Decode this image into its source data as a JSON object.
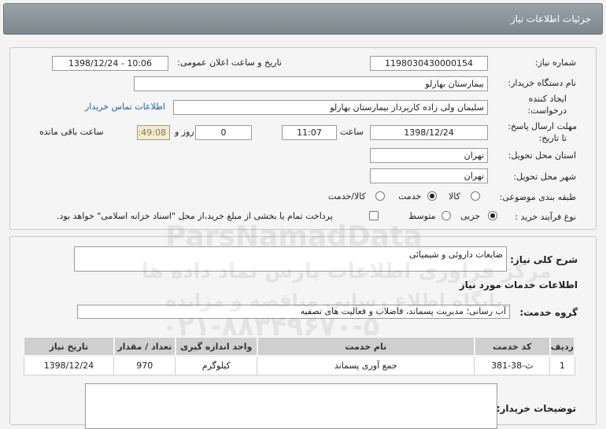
{
  "header": {
    "title": "جزئیات اطلاعات نیاز"
  },
  "details": {
    "need_number_label": "شماره نیاز:",
    "need_number": "1198030430000154",
    "announce_label": "تاریخ و ساعت اعلان عمومی:",
    "announce_value": "1398/12/24 - 10:06",
    "buyer_label": "نام دستگاه خریدار:",
    "buyer_value": "بیمارستان بهارلو",
    "creator_label_1": "ایجاد کننده",
    "creator_label_2": "درخواست:",
    "creator_value": "سلیمان  ولی زاده  کارپرداز بیمارستان بهارلو",
    "contact_link": "اطلاعات تماس خریدار",
    "deadline_label_1": "مهلت ارسال پاسخ:",
    "deadline_label_2": "تا تاریخ:",
    "deadline_date": "1398/12/24",
    "time_label": "ساعت",
    "deadline_time": "11:07",
    "days_value": "0",
    "days_label": "روز و",
    "remaining_time": "00:49:08",
    "remaining_label": "ساعت باقی مانده",
    "province_label": "استان محل تحویل:",
    "province_value": "تهران",
    "city_label": "شهر محل تحویل:",
    "city_value": "تهران",
    "category_label": "طبقه بندی موضوعی:",
    "category_options": [
      "کالا",
      "خدمت",
      "کالا/خدمت"
    ],
    "category_selected": "خدمت",
    "process_label": "نوع فرآیند خرید :",
    "process_options": [
      "جزیی",
      "متوسط"
    ],
    "process_selected": "جزیی",
    "payment_note": "پرداخت تمام یا بخشی از مبلغ خرید،از محل \"اسناد خزانه اسلامی\" خواهد بود."
  },
  "summary": {
    "label": "شرح کلی نیاز:",
    "value": "ضایعات داروئی و شیمیائی",
    "services_heading": "اطلاعات خدمات مورد نیاز",
    "group_label": "گروه خدمت:",
    "group_value": "آب رسانی؛ مدیریت پسماند، فاضلاب و فعالیت های تصفیه"
  },
  "table": {
    "headers": [
      "ردیف",
      "کد خدمت",
      "نام خدمت",
      "واحد اندازه گیری",
      "تعداد / مقدار",
      "تاریخ نیاز"
    ],
    "rows": [
      [
        "1",
        "ث-38-381",
        "جمع آوری پسماند",
        "کیلوگرم",
        "970",
        "1398/12/24"
      ]
    ]
  },
  "notes": {
    "label": "توضیحات خریدار:",
    "value": ""
  },
  "watermark": {
    "line1": "ParsNamadData",
    "line2": "مرکز فراوری اطلاعات پارس نماد داده ها",
    "line3": "پایگاه اطلاع رسانی مناقصه و مزایده",
    "line4": "۰۲۱-۸۸۳۴۹۶۷۰-۵"
  }
}
